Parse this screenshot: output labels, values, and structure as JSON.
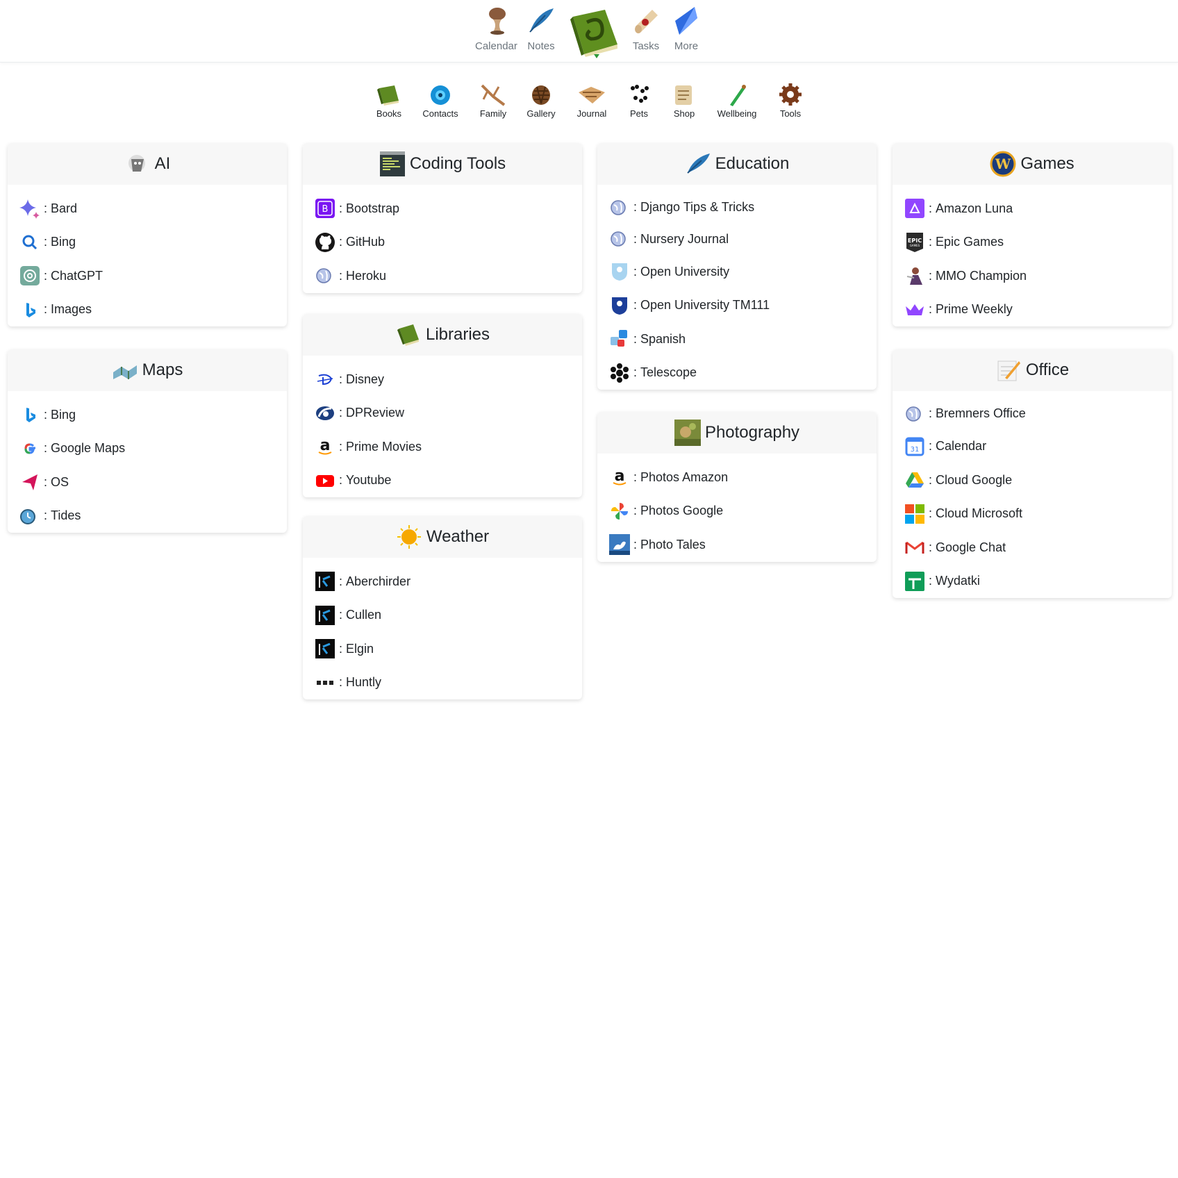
{
  "top_nav": {
    "items": [
      {
        "label": "Calendar",
        "icon": "hourglass-icon"
      },
      {
        "label": "Notes",
        "icon": "quill-icon"
      },
      {
        "label": "Tasks",
        "icon": "scroll-icon"
      },
      {
        "label": "More",
        "icon": "crystal-icon"
      }
    ],
    "logo_icon": "spellbook-logo-icon"
  },
  "sub_nav": {
    "items": [
      {
        "label": "Books",
        "icon": "book-icon"
      },
      {
        "label": "Contacts",
        "icon": "eye-orb-icon"
      },
      {
        "label": "Family",
        "icon": "branch-icon"
      },
      {
        "label": "Gallery",
        "icon": "pinecone-icon"
      },
      {
        "label": "Journal",
        "icon": "open-book-icon"
      },
      {
        "label": "Pets",
        "icon": "paw-prints-icon"
      },
      {
        "label": "Shop",
        "icon": "scroll-icon"
      },
      {
        "label": "Wellbeing",
        "icon": "potion-icon"
      },
      {
        "label": "Tools",
        "icon": "gear-icon"
      }
    ]
  },
  "separator": ":",
  "cards": {
    "ai": {
      "title": "AI",
      "links": [
        "Bard",
        "Bing",
        "ChatGPT",
        "Images"
      ]
    },
    "maps": {
      "title": "Maps",
      "links": [
        "Bing",
        "Google Maps",
        "OS",
        "Tides"
      ]
    },
    "coding": {
      "title": "Coding Tools",
      "links": [
        "Bootstrap",
        "GitHub",
        "Heroku"
      ]
    },
    "libraries": {
      "title": "Libraries",
      "links": [
        "Disney",
        "DPReview",
        "Prime Movies",
        "Youtube"
      ]
    },
    "weather": {
      "title": "Weather",
      "links": [
        "Aberchirder",
        "Cullen",
        "Elgin",
        "Huntly"
      ]
    },
    "education": {
      "title": "Education",
      "links": [
        "Django Tips & Tricks",
        "Nursery Journal",
        "Open University",
        "Open University TM111",
        "Spanish",
        "Telescope"
      ]
    },
    "photography": {
      "title": "Photography",
      "links": [
        "Photos Amazon",
        "Photos Google",
        "Photo Tales"
      ]
    },
    "games": {
      "title": "Games",
      "links": [
        "Amazon Luna",
        "Epic Games",
        "MMO Champion",
        "Prime Weekly"
      ]
    },
    "office": {
      "title": "Office",
      "links": [
        "Bremners Office",
        "Calendar",
        "Cloud Google",
        "Cloud Microsoft",
        "Google Chat",
        "Wydatki"
      ]
    }
  },
  "colors": {
    "header_bg": "#f7f7f7",
    "nav_text": "#6c757d",
    "card_shadow": "rgba(0,0,0,0.13)"
  }
}
